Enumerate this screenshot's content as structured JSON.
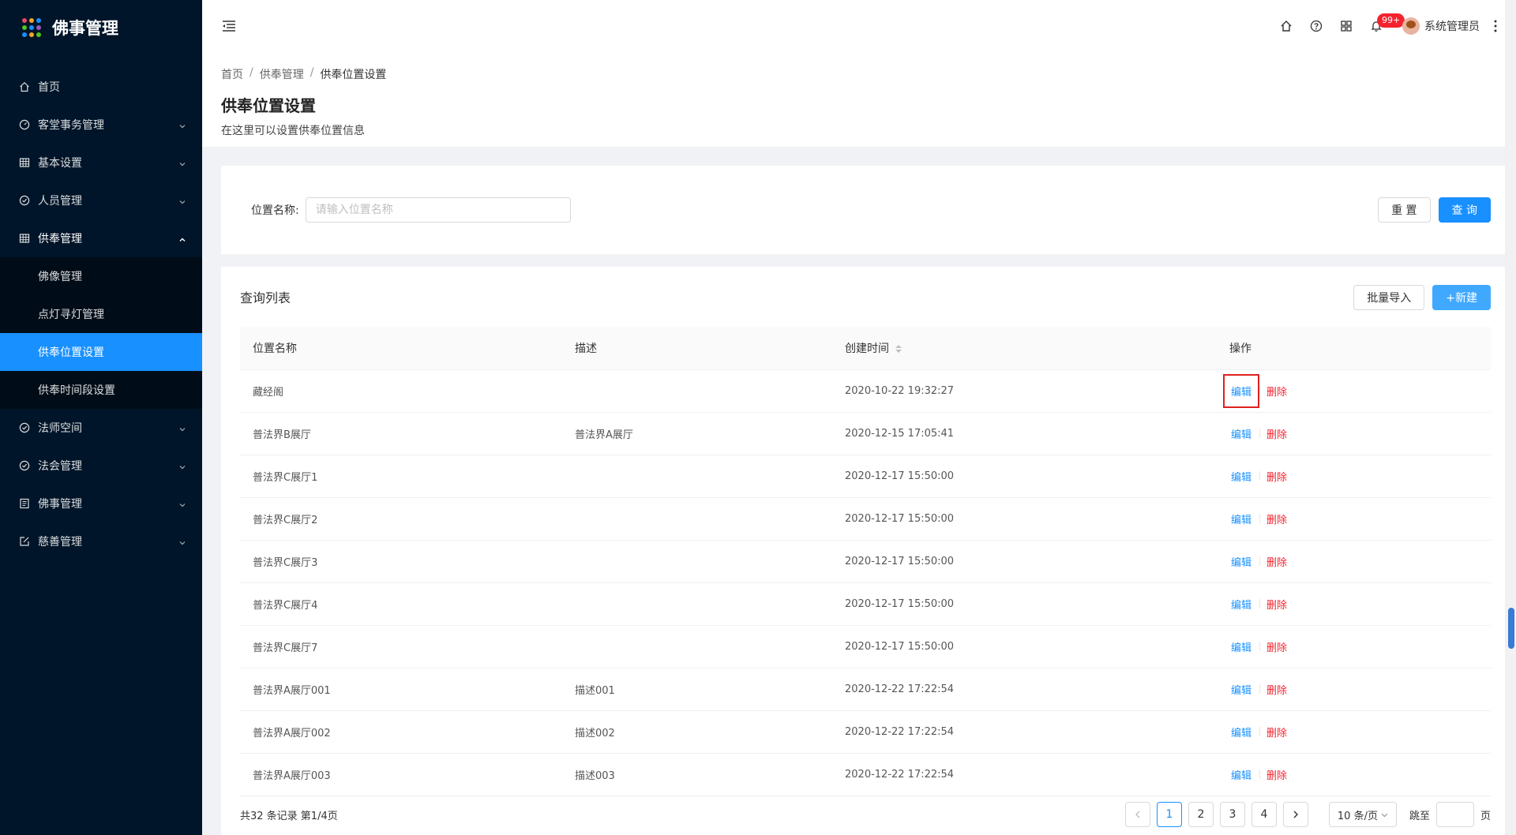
{
  "app": {
    "title": "佛事管理",
    "logo_colors": [
      "#e84a5f",
      "#f5a623",
      "#1890ff",
      "#52c41a",
      "#1890ff",
      "#9b59b6",
      "#1890ff",
      "#f5a623",
      "#52c41a"
    ]
  },
  "sidebar": {
    "items": [
      {
        "label": "首页",
        "icon": "home-icon",
        "has_children": false
      },
      {
        "label": "客堂事务管理",
        "icon": "dashboard-icon",
        "has_children": true
      },
      {
        "label": "基本设置",
        "icon": "table-icon",
        "has_children": true
      },
      {
        "label": "人员管理",
        "icon": "check-circle-icon",
        "has_children": true
      },
      {
        "label": "供奉管理",
        "icon": "table-icon",
        "has_children": true,
        "open": true,
        "children": [
          {
            "label": "佛像管理"
          },
          {
            "label": "点灯寻灯管理"
          },
          {
            "label": "供奉位置设置",
            "active": true
          },
          {
            "label": "供奉时间段设置"
          }
        ]
      },
      {
        "label": "法师空间",
        "icon": "check-circle-icon",
        "has_children": true
      },
      {
        "label": "法会管理",
        "icon": "check-circle-icon",
        "has_children": true
      },
      {
        "label": "佛事管理",
        "icon": "profile-icon",
        "has_children": true
      },
      {
        "label": "慈善管理",
        "icon": "edit-icon",
        "has_children": true
      }
    ]
  },
  "header": {
    "notification_badge": "99+",
    "user_name": "系统管理员"
  },
  "breadcrumb": [
    "首页",
    "供奉管理",
    "供奉位置设置"
  ],
  "page": {
    "title": "供奉位置设置",
    "description": "在这里可以设置供奉位置信息"
  },
  "search": {
    "label": "位置名称:",
    "placeholder": "请输入位置名称",
    "value": "",
    "reset_label": "重 置",
    "query_label": "查 询"
  },
  "list": {
    "title": "查询列表",
    "import_label": "批量导入",
    "new_label": "+新建",
    "columns": [
      "位置名称",
      "描述",
      "创建时间",
      "操作"
    ],
    "edit_label": "编辑",
    "delete_label": "删除",
    "rows": [
      {
        "name": "藏经阁",
        "desc": "",
        "created": "2020-10-22 19:32:27"
      },
      {
        "name": "普法界B展厅",
        "desc": "普法界A展厅",
        "created": "2020-12-15 17:05:41"
      },
      {
        "name": "普法界C展厅1",
        "desc": "",
        "created": "2020-12-17 15:50:00"
      },
      {
        "name": "普法界C展厅2",
        "desc": "",
        "created": "2020-12-17 15:50:00"
      },
      {
        "name": "普法界C展厅3",
        "desc": "",
        "created": "2020-12-17 15:50:00"
      },
      {
        "name": "普法界C展厅4",
        "desc": "",
        "created": "2020-12-17 15:50:00"
      },
      {
        "name": "普法界C展厅7",
        "desc": "",
        "created": "2020-12-17 15:50:00"
      },
      {
        "name": "普法界A展厅001",
        "desc": "描述001",
        "created": "2020-12-22 17:22:54"
      },
      {
        "name": "普法界A展厅002",
        "desc": "描述002",
        "created": "2020-12-22 17:22:54"
      },
      {
        "name": "普法界A展厅003",
        "desc": "描述003",
        "created": "2020-12-22 17:22:54"
      }
    ]
  },
  "pagination": {
    "total_text": "共32 条记录 第1/4页",
    "pages": [
      "1",
      "2",
      "3",
      "4"
    ],
    "current": "1",
    "page_size": "10 条/页",
    "jump_label": "跳至",
    "page_suffix": "页"
  }
}
